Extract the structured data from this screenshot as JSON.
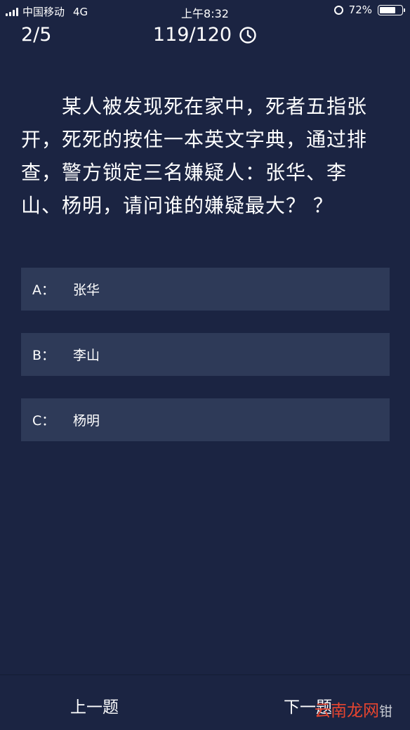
{
  "status_bar": {
    "carrier": "中国移动",
    "network": "4G",
    "time": "上午8:32",
    "battery": "72%",
    "battery_level": 0.72
  },
  "quiz": {
    "progress": "2/5",
    "timer": "119/120",
    "question": "某人被发现死在家中，死者五指张开，死死的按住一本英文字典，通过排查，警方锁定三名嫌疑人：张华、李山、杨明，请问谁的嫌疑最大？ ？",
    "options": [
      {
        "letter": "A：",
        "text": "张华"
      },
      {
        "letter": "B：",
        "text": "李山"
      },
      {
        "letter": "C：",
        "text": "杨明"
      }
    ]
  },
  "nav": {
    "prev": "上一题",
    "next": "下一题"
  },
  "watermark": {
    "brand": "云南龙网",
    "extra": "钳"
  },
  "colors": {
    "background": "#1b2442",
    "option_bg": "#2e3a58",
    "text": "#ffffff",
    "watermark": "#e8452f"
  }
}
